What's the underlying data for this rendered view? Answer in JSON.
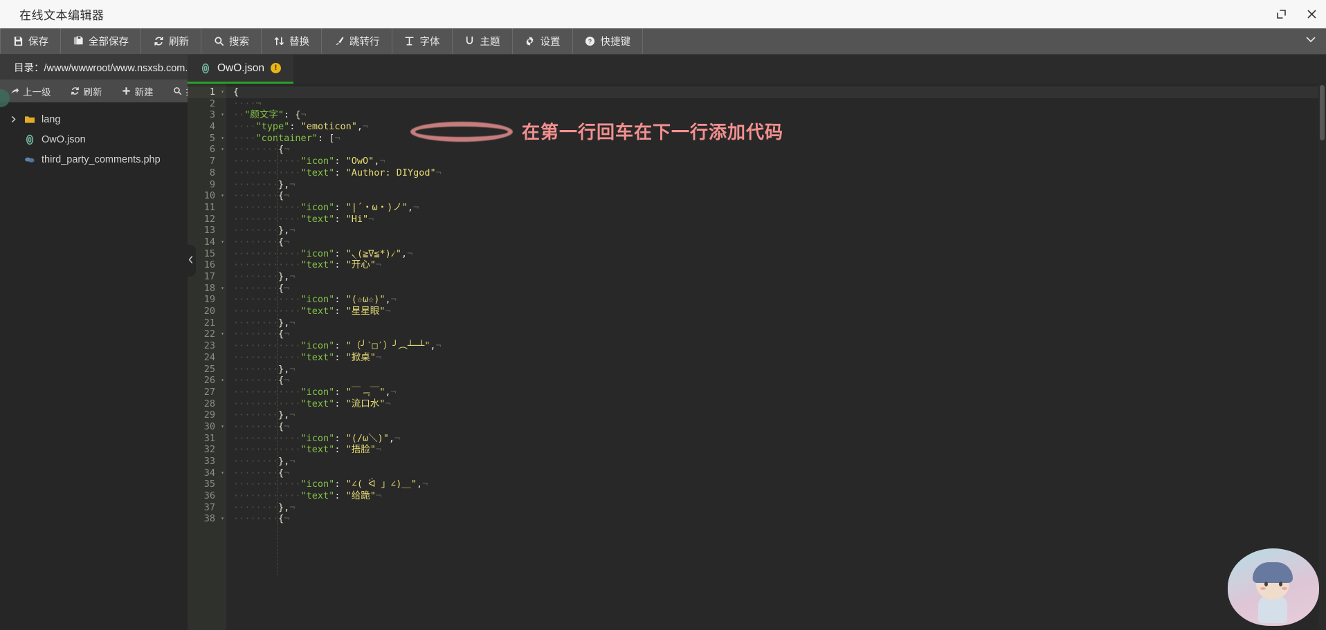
{
  "window": {
    "title": "在线文本编辑器",
    "controls": [
      {
        "name": "restore-window-button",
        "icon": "restore-icon"
      },
      {
        "name": "close-window-button",
        "icon": "close-icon"
      }
    ]
  },
  "toolbar": {
    "items": [
      {
        "label": "保存",
        "icon": "save-icon"
      },
      {
        "label": "全部保存",
        "icon": "save-all-icon"
      },
      {
        "label": "刷新",
        "icon": "refresh-icon"
      },
      {
        "label": "搜索",
        "icon": "search-icon"
      },
      {
        "label": "替换",
        "icon": "replace-icon"
      },
      {
        "label": "跳转行",
        "icon": "goto-line-icon"
      },
      {
        "label": "字体",
        "icon": "font-icon"
      },
      {
        "label": "主题",
        "icon": "theme-icon"
      },
      {
        "label": "设置",
        "icon": "gear-icon"
      },
      {
        "label": "快捷键",
        "icon": "help-circle-icon"
      }
    ],
    "collapse_icon": "chevron-down-icon"
  },
  "sidebar": {
    "directory_label": "目录：/www/wwwroot/www.nsxsb.com...",
    "actions": [
      {
        "label": "上一级",
        "icon": "arrow-up-level-icon"
      },
      {
        "label": "刷新",
        "icon": "refresh-icon"
      },
      {
        "label": "新建",
        "icon": "plus-icon"
      },
      {
        "label": "搜索",
        "icon": "search-icon"
      }
    ],
    "tree": [
      {
        "label": "lang",
        "icon": "folder-icon",
        "type": "folder",
        "expandable": true
      },
      {
        "label": "OwO.json",
        "icon": "json-file-icon",
        "type": "file",
        "expandable": false
      },
      {
        "label": "third_party_comments.php",
        "icon": "php-file-icon",
        "type": "file",
        "expandable": false
      }
    ],
    "collapse_handle_icon": "chevron-left-icon"
  },
  "editor": {
    "tab": {
      "label": "OwO.json",
      "icon": "json-file-icon",
      "modified_badge": "!",
      "modified_badge_name": "unsaved-changes-badge"
    },
    "annotation": {
      "text": "在第一行回车在下一行添加代码",
      "color": "#f3908f",
      "highlight_shape": "ellipse"
    },
    "current_line": 1,
    "lines": [
      {
        "n": 1,
        "fold": true,
        "indent": "",
        "text": "{",
        "cr": false
      },
      {
        "n": 2,
        "fold": false,
        "indent": "····",
        "text": "",
        "cr": true
      },
      {
        "n": 3,
        "fold": true,
        "indent": "··",
        "text": "\"颜文字\": {",
        "cr": true
      },
      {
        "n": 4,
        "fold": false,
        "indent": "····",
        "text": "\"type\": \"emoticon\",",
        "cr": true
      },
      {
        "n": 5,
        "fold": true,
        "indent": "····",
        "text": "\"container\": [",
        "cr": true
      },
      {
        "n": 6,
        "fold": true,
        "indent": "········",
        "text": "{",
        "cr": true
      },
      {
        "n": 7,
        "fold": false,
        "indent": "············",
        "text": "\"icon\": \"OwO\",",
        "cr": true
      },
      {
        "n": 8,
        "fold": false,
        "indent": "············",
        "text": "\"text\": \"Author: DIYgod\"",
        "cr": true
      },
      {
        "n": 9,
        "fold": false,
        "indent": "········",
        "text": "},",
        "cr": true
      },
      {
        "n": 10,
        "fold": true,
        "indent": "········",
        "text": "{",
        "cr": true
      },
      {
        "n": 11,
        "fold": false,
        "indent": "············",
        "text": "\"icon\": \"|´・ω・)ノ\",",
        "cr": true
      },
      {
        "n": 12,
        "fold": false,
        "indent": "············",
        "text": "\"text\": \"Hi\"",
        "cr": true
      },
      {
        "n": 13,
        "fold": false,
        "indent": "········",
        "text": "},",
        "cr": true
      },
      {
        "n": 14,
        "fold": true,
        "indent": "········",
        "text": "{",
        "cr": true
      },
      {
        "n": 15,
        "fold": false,
        "indent": "············",
        "text": "\"icon\": \"৲(≧∇≦*)৴\",",
        "cr": true
      },
      {
        "n": 16,
        "fold": false,
        "indent": "············",
        "text": "\"text\": \"开心\"",
        "cr": true
      },
      {
        "n": 17,
        "fold": false,
        "indent": "········",
        "text": "},",
        "cr": true
      },
      {
        "n": 18,
        "fold": true,
        "indent": "········",
        "text": "{",
        "cr": true
      },
      {
        "n": 19,
        "fold": false,
        "indent": "············",
        "text": "\"icon\": \"(☆ω☆)\",",
        "cr": true
      },
      {
        "n": 20,
        "fold": false,
        "indent": "············",
        "text": "\"text\": \"星星眼\"",
        "cr": true
      },
      {
        "n": 21,
        "fold": false,
        "indent": "········",
        "text": "},",
        "cr": true
      },
      {
        "n": 22,
        "fold": true,
        "indent": "········",
        "text": "{",
        "cr": true
      },
      {
        "n": 23,
        "fold": false,
        "indent": "············",
        "text": "\"icon\": \"（╯‵□′）╯︵┴─┴\",",
        "cr": true
      },
      {
        "n": 24,
        "fold": false,
        "indent": "············",
        "text": "\"text\": \"掀桌\"",
        "cr": true
      },
      {
        "n": 25,
        "fold": false,
        "indent": "········",
        "text": "},",
        "cr": true
      },
      {
        "n": 26,
        "fold": true,
        "indent": "········",
        "text": "{",
        "cr": true
      },
      {
        "n": 27,
        "fold": false,
        "indent": "············",
        "text": "\"icon\": \"￣﹃￣\",",
        "cr": true
      },
      {
        "n": 28,
        "fold": false,
        "indent": "············",
        "text": "\"text\": \"流口水\"",
        "cr": true
      },
      {
        "n": 29,
        "fold": false,
        "indent": "········",
        "text": "},",
        "cr": true
      },
      {
        "n": 30,
        "fold": true,
        "indent": "········",
        "text": "{",
        "cr": true
      },
      {
        "n": 31,
        "fold": false,
        "indent": "············",
        "text": "\"icon\": \"(/ω＼)\",",
        "cr": true
      },
      {
        "n": 32,
        "fold": false,
        "indent": "············",
        "text": "\"text\": \"捂脸\"",
        "cr": true
      },
      {
        "n": 33,
        "fold": false,
        "indent": "········",
        "text": "},",
        "cr": true
      },
      {
        "n": 34,
        "fold": true,
        "indent": "········",
        "text": "{",
        "cr": true
      },
      {
        "n": 35,
        "fold": false,
        "indent": "············",
        "text": "\"icon\": \"∠( ᐛ 」∠)＿\",",
        "cr": true
      },
      {
        "n": 36,
        "fold": false,
        "indent": "············",
        "text": "\"text\": \"给跪\"",
        "cr": true
      },
      {
        "n": 37,
        "fold": false,
        "indent": "········",
        "text": "},",
        "cr": true
      },
      {
        "n": 38,
        "fold": true,
        "indent": "········",
        "text": "{",
        "cr": true
      }
    ]
  },
  "colors": {
    "titlebar_bg": "#f7f7f7",
    "toolbar_bg": "#545454",
    "sidebar_bg": "#262626",
    "editor_bg": "#282828",
    "tab_accent": "#2aa02a",
    "string": "#e6db74",
    "key": "#85c247",
    "annotation": "#f3908f",
    "badge": "#e8b517"
  }
}
